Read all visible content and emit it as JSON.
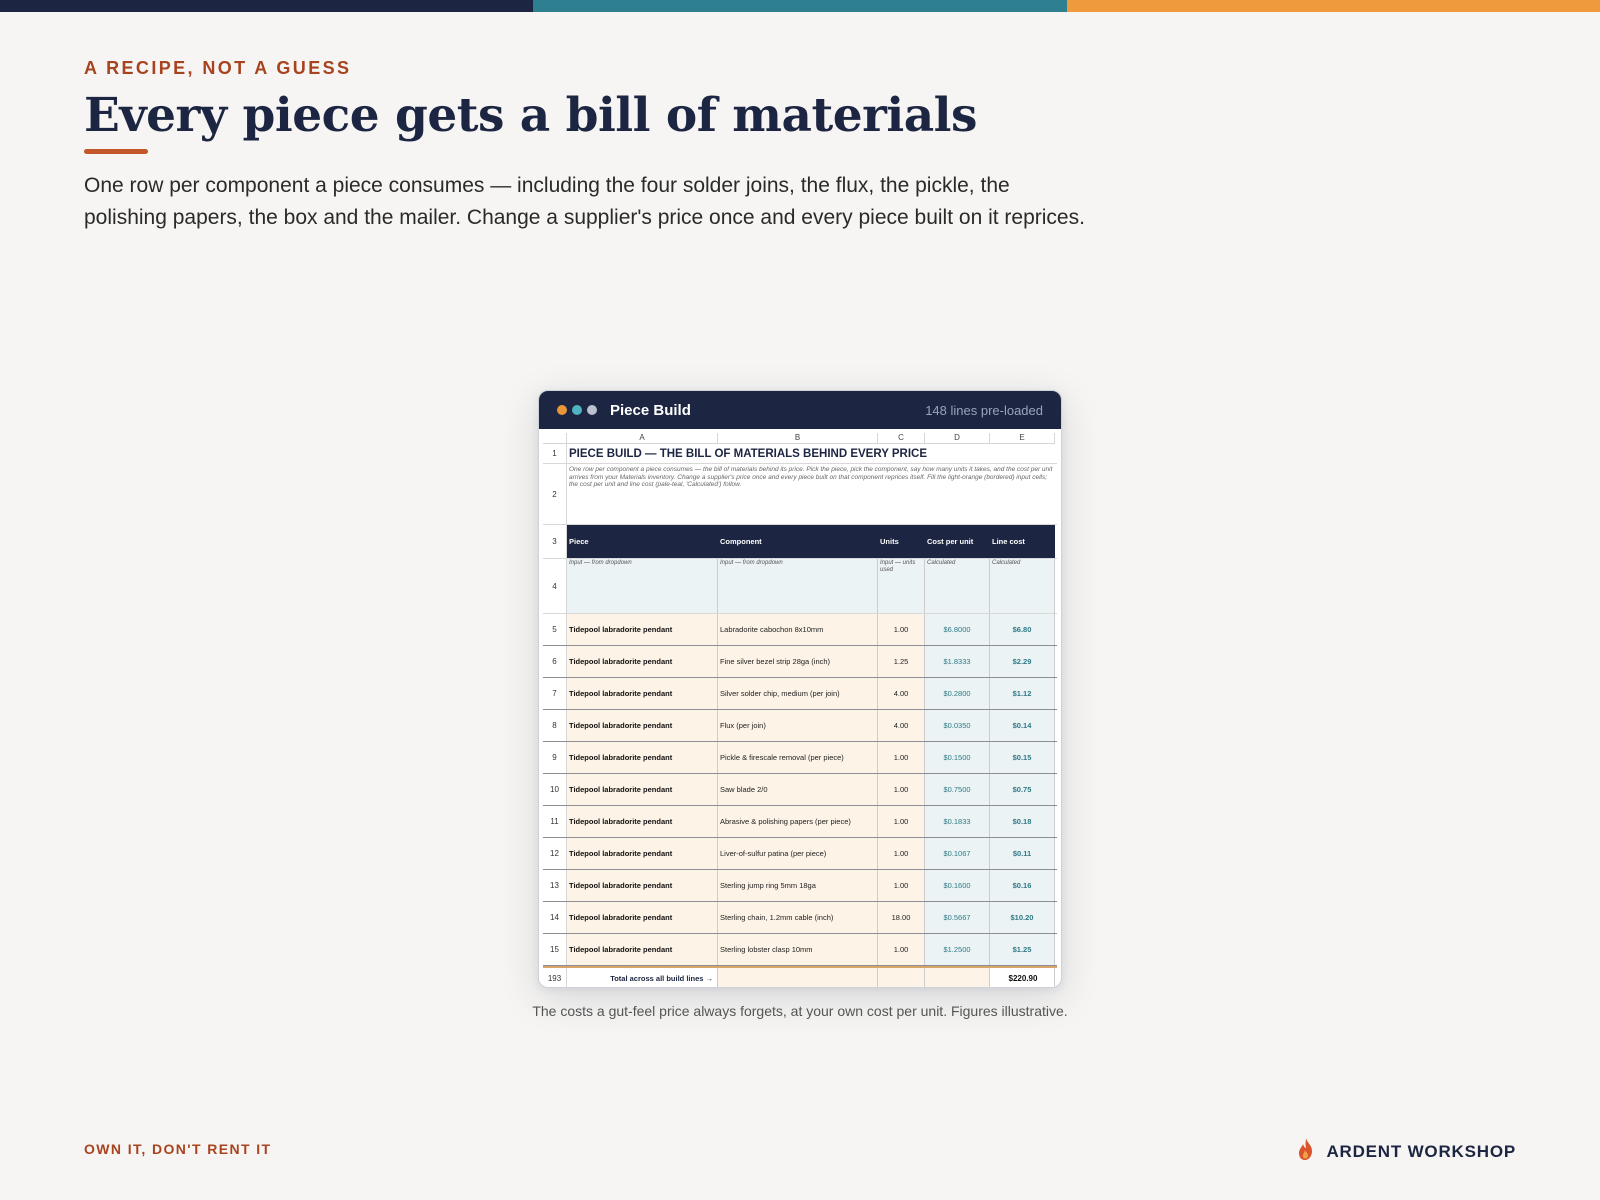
{
  "colors": {
    "navy": "#1c2541",
    "teal": "#2e7f8f",
    "orange": "#ef9a3c",
    "rust": "#a8431f",
    "input_fill": "#fdf3e6",
    "calc_fill": "#ebf3f5"
  },
  "eyebrow": "A RECIPE, NOT A GUESS",
  "title": "Every piece gets a bill of materials",
  "lede": "One row per component a piece consumes — including the four solder joins, the flux, the pickle, the polishing papers, the box and the mailer. Change a supplier's price once and every piece built on it reprices.",
  "window": {
    "title": "Piece Build",
    "meta": "148 lines pre-loaded",
    "dots": [
      "#e9953a",
      "#4fb3c0",
      "#b9c1cf"
    ]
  },
  "sheet": {
    "columns": [
      "A",
      "B",
      "C",
      "D",
      "E"
    ],
    "row1": {
      "num": "1",
      "text": "PIECE BUILD — THE BILL OF MATERIALS BEHIND EVERY PRICE"
    },
    "row2": {
      "num": "2",
      "text": "One row per component a piece consumes — the bill of materials behind its price. Pick the piece, pick the component, say how many units it takes, and the cost per unit arrives from your Materials inventory. Change a supplier's price once and every piece built on that component reprices itself.  Fill the light-orange (bordered) input cells; the cost per unit and line cost (pale-teal, 'Calculated') follow."
    },
    "row3": {
      "num": "3",
      "headers": [
        "Piece",
        "Component",
        "Units",
        "Cost per unit",
        "Line cost"
      ]
    },
    "row4": {
      "num": "4",
      "notes": [
        "Input — from dropdown",
        "Input — from dropdown",
        "Input — units used",
        "Calculated",
        "Calculated"
      ]
    },
    "rows": [
      {
        "num": "5",
        "piece": "Tidepool labradorite pendant",
        "component": "Labradorite cabochon 8x10mm",
        "units": "1.00",
        "cost": "$6.8000",
        "line": "$6.80"
      },
      {
        "num": "6",
        "piece": "Tidepool labradorite pendant",
        "component": "Fine silver bezel strip 28ga (inch)",
        "units": "1.25",
        "cost": "$1.8333",
        "line": "$2.29"
      },
      {
        "num": "7",
        "piece": "Tidepool labradorite pendant",
        "component": "Silver solder chip, medium (per join)",
        "units": "4.00",
        "cost": "$0.2800",
        "line": "$1.12"
      },
      {
        "num": "8",
        "piece": "Tidepool labradorite pendant",
        "component": "Flux (per join)",
        "units": "4.00",
        "cost": "$0.0350",
        "line": "$0.14"
      },
      {
        "num": "9",
        "piece": "Tidepool labradorite pendant",
        "component": "Pickle & firescale removal (per piece)",
        "units": "1.00",
        "cost": "$0.1500",
        "line": "$0.15"
      },
      {
        "num": "10",
        "piece": "Tidepool labradorite pendant",
        "component": "Saw blade 2/0",
        "units": "1.00",
        "cost": "$0.7500",
        "line": "$0.75"
      },
      {
        "num": "11",
        "piece": "Tidepool labradorite pendant",
        "component": "Abrasive & polishing papers (per piece)",
        "units": "1.00",
        "cost": "$0.1833",
        "line": "$0.18"
      },
      {
        "num": "12",
        "piece": "Tidepool labradorite pendant",
        "component": "Liver-of-sulfur patina (per piece)",
        "units": "1.00",
        "cost": "$0.1067",
        "line": "$0.11"
      },
      {
        "num": "13",
        "piece": "Tidepool labradorite pendant",
        "component": "Sterling jump ring 5mm 18ga",
        "units": "1.00",
        "cost": "$0.1600",
        "line": "$0.16"
      },
      {
        "num": "14",
        "piece": "Tidepool labradorite pendant",
        "component": "Sterling chain, 1.2mm cable (inch)",
        "units": "18.00",
        "cost": "$0.5667",
        "line": "$10.20"
      },
      {
        "num": "15",
        "piece": "Tidepool labradorite pendant",
        "component": "Sterling lobster clasp 10mm",
        "units": "1.00",
        "cost": "$1.2500",
        "line": "$1.25"
      }
    ],
    "total": {
      "num": "193",
      "label": "Total across all build lines →",
      "value": "$220.90"
    }
  },
  "caption": "The costs a gut-feel price always forgets, at your own cost per unit. Figures illustrative.",
  "footer": {
    "tagline": "OWN IT, DON'T RENT IT",
    "brand": "ARDENT WORKSHOP",
    "brand_icon": "flame-icon"
  }
}
